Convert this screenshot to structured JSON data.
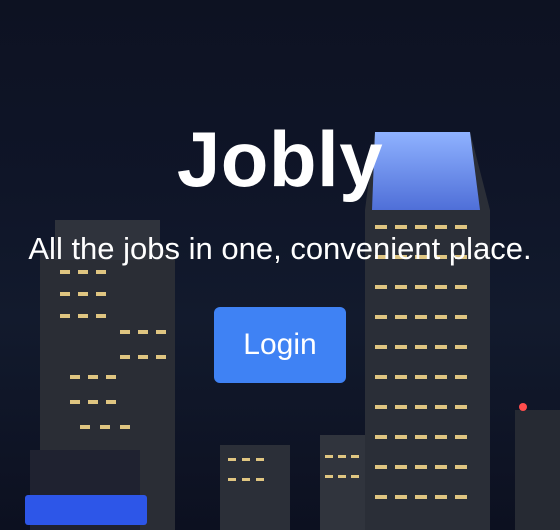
{
  "hero": {
    "title": "Jobly",
    "subtitle": "All the jobs in one, convenient place.",
    "login_label": "Login"
  },
  "colors": {
    "button": "#3f82f4",
    "text": "#ffffff",
    "background": "#0f1528"
  }
}
